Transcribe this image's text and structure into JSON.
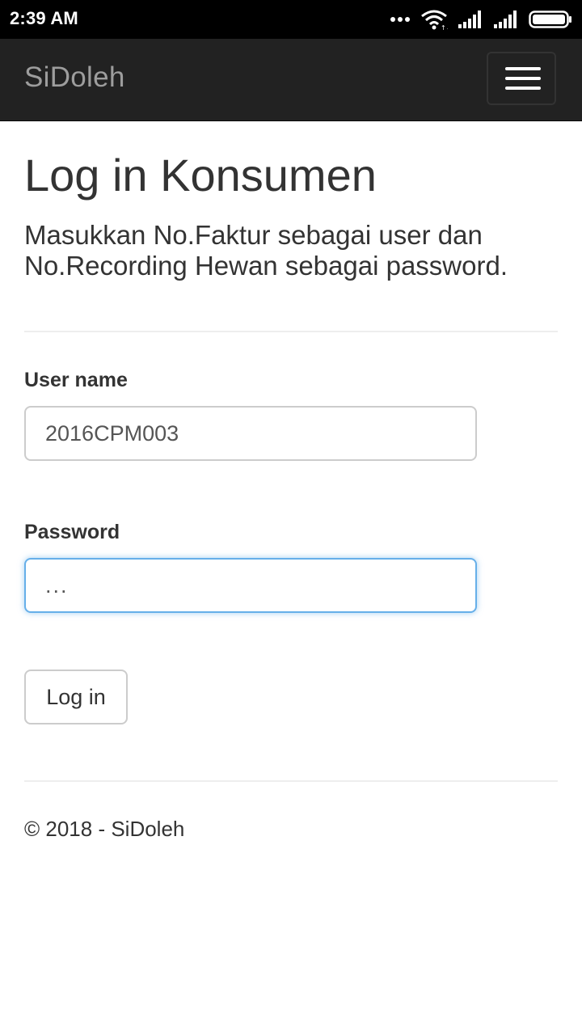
{
  "status_bar": {
    "time": "2:39 AM",
    "icons": [
      "more-dots-icon",
      "wifi-icon",
      "signal-icon",
      "signal-icon",
      "battery-icon"
    ]
  },
  "navbar": {
    "brand": "SiDoleh",
    "toggle_icon": "hamburger-menu-icon",
    "background": "#222222",
    "brand_color": "#9d9d9d"
  },
  "login": {
    "title": "Log in Konsumen",
    "subtitle": "Masukkan No.Faktur sebagai user dan No.Recording Hewan sebagai password.",
    "username_label": "User name",
    "username_value": "2016CPM003",
    "password_label": "Password",
    "password_value": "...",
    "submit_label": "Log in",
    "focus_color": "#66afe9"
  },
  "footer": {
    "text": "© 2018 - SiDoleh"
  }
}
